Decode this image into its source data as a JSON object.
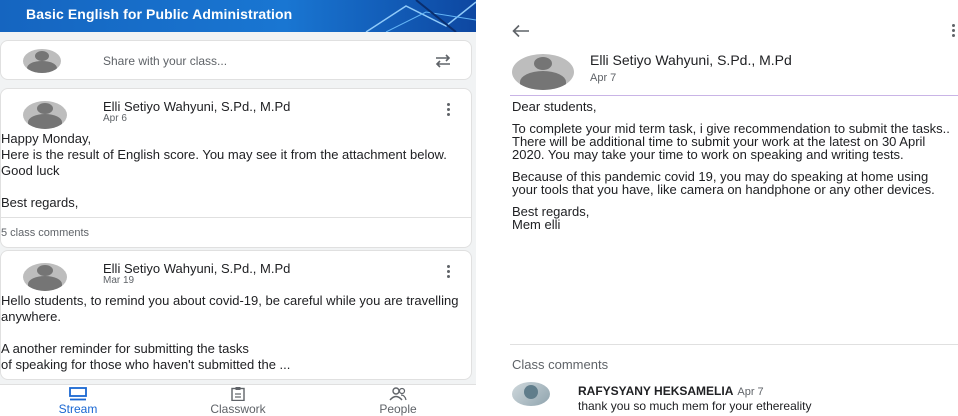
{
  "stream": {
    "class_title": "Basic English for Public Administration",
    "share_placeholder": "Share with your class...",
    "posts": [
      {
        "author": "Elli Setiyo Wahyuni, S.Pd., M.Pd",
        "date": "Apr 6",
        "body": "Happy Monday,\nHere is the result of English score. You may see it from the attachment below. Good luck\n\nBest regards,",
        "comments": "5 class comments"
      },
      {
        "author": "Elli Setiyo Wahyuni, S.Pd., M.Pd",
        "date": "Mar 19",
        "body": "Hello students, to remind you about covid-19, be careful while you are travelling anywhere.\n\nA another reminder for submitting the tasks\nof speaking for those who haven't submitted the ..."
      }
    ]
  },
  "bottom_nav": {
    "items": [
      {
        "label": "Stream",
        "icon": "stream-icon",
        "active": true
      },
      {
        "label": "Classwork",
        "icon": "classwork-icon",
        "active": false
      },
      {
        "label": "People",
        "icon": "people-icon",
        "active": false
      }
    ]
  },
  "detail": {
    "author": "Elli Setiyo Wahyuni, S.Pd., M.Pd",
    "date": "Apr 7",
    "paragraphs": [
      "Dear students,",
      "To complete your mid term task, i give recommendation to submit the tasks.. There will be additional time to submit your work at the latest on 30 April 2020. You may take your time to work on speaking and writing tests.",
      "Because of this pandemic covid 19, you may do speaking at home using your tools that you have, like camera on handphone or any other devices.",
      "Best regards,\nMem elli"
    ],
    "comments_title": "Class comments",
    "comment": {
      "name": "RAFYSYANY HEKSAMELIA",
      "date": "Apr 7",
      "text": "thank you so much mem for your ethereality"
    }
  },
  "colors": {
    "accent": "#1967d2",
    "banner": "#1976d2",
    "divider_purple": "#c9b4e6"
  }
}
